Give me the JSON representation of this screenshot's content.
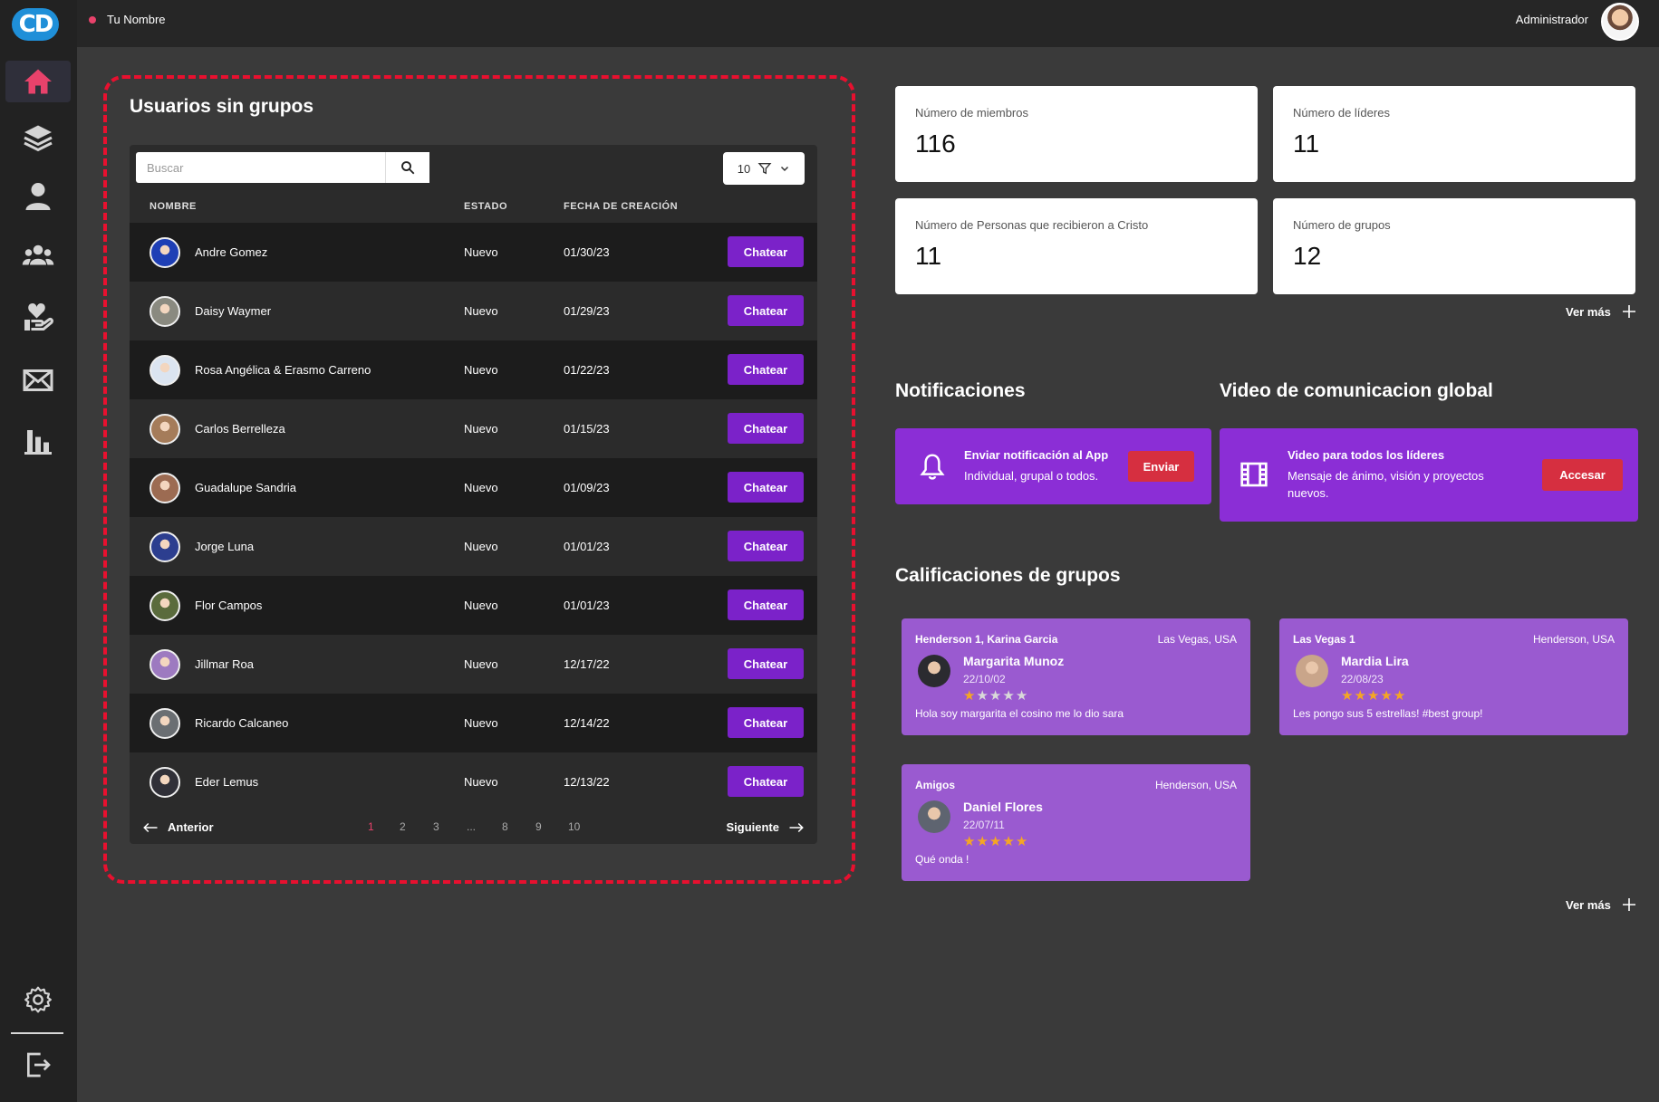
{
  "topbar": {
    "username": "Tu Nombre",
    "admin_label": "Administrador"
  },
  "sidebar": {
    "logo_text": "CD",
    "items": [
      {
        "icon": "home-icon",
        "active": true
      },
      {
        "icon": "layers-icon"
      },
      {
        "icon": "user-icon"
      },
      {
        "icon": "group-icon"
      },
      {
        "icon": "heart-hand-icon"
      },
      {
        "icon": "mail-icon"
      },
      {
        "icon": "bar-chart-icon"
      }
    ],
    "bottom_items": [
      {
        "icon": "gear-icon"
      },
      {
        "icon": "logout-icon"
      }
    ]
  },
  "users_panel": {
    "title": "Usuarios sin grupos",
    "search_placeholder": "Buscar",
    "page_size": "10",
    "headers": {
      "name": "NOMBRE",
      "state": "ESTADO",
      "date": "FECHA DE CREACIÓN"
    },
    "chat_label": "Chatear",
    "rows": [
      {
        "name": "Andre Gomez",
        "state": "Nuevo",
        "date": "01/30/23",
        "avatar_color": "#1e3fb5"
      },
      {
        "name": "Daisy Waymer",
        "state": "Nuevo",
        "date": "01/29/23",
        "avatar_color": "#8a8a80"
      },
      {
        "name": "Rosa Angélica & Erasmo Carreno",
        "state": "Nuevo",
        "date": "01/22/23",
        "avatar_color": "#dbe4f0"
      },
      {
        "name": "Carlos Berrelleza",
        "state": "Nuevo",
        "date": "01/15/23",
        "avatar_color": "#a57c5a"
      },
      {
        "name": "Guadalupe Sandria",
        "state": "Nuevo",
        "date": "01/09/23",
        "avatar_color": "#9c6b52"
      },
      {
        "name": "Jorge Luna",
        "state": "Nuevo",
        "date": "01/01/23",
        "avatar_color": "#2c3e8f"
      },
      {
        "name": "Flor Campos",
        "state": "Nuevo",
        "date": "01/01/23",
        "avatar_color": "#5a6b3c"
      },
      {
        "name": "Jillmar Roa",
        "state": "Nuevo",
        "date": "12/17/22",
        "avatar_color": "#9d7ac0"
      },
      {
        "name": "Ricardo Calcaneo",
        "state": "Nuevo",
        "date": "12/14/22",
        "avatar_color": "#6a6e72"
      },
      {
        "name": "Eder Lemus",
        "state": "Nuevo",
        "date": "12/13/22",
        "avatar_color": "#303038"
      }
    ],
    "pager": {
      "prev_label": "Anterior",
      "next_label": "Siguiente",
      "pages": [
        "1",
        "2",
        "3",
        "...",
        "8",
        "9",
        "10"
      ],
      "current": "1"
    }
  },
  "stats": [
    {
      "label": "Número de miembros",
      "value": "116"
    },
    {
      "label": "Número de líderes",
      "value": "11"
    },
    {
      "label": "Número de Personas que recibieron a Cristo",
      "value": "11"
    },
    {
      "label": "Número de grupos",
      "value": "12"
    }
  ],
  "stats_more": "Ver más",
  "notifications": {
    "title": "Notificaciones",
    "card_title": "Enviar notificación al App",
    "card_sub": "Individual, grupal o todos.",
    "button": "Enviar"
  },
  "video": {
    "title": "Video de comunicacion global",
    "card_title": "Video para todos los líderes",
    "card_sub": "Mensaje de ánimo, visión y proyectos nuevos.",
    "button": "Accesar"
  },
  "ratings": {
    "title": "Calificaciones de grupos",
    "more": "Ver más",
    "items": [
      {
        "group": "Henderson 1, Karina Garcia",
        "location": "Las Vegas, USA",
        "name": "Margarita Munoz",
        "date": "22/10/02",
        "stars": 1,
        "comment": "Hola soy margarita el cosino me lo dio sara",
        "avatar_color": "#2b2b30"
      },
      {
        "group": "Las Vegas 1",
        "location": "Henderson, USA",
        "name": "Mardia Lira",
        "date": "22/08/23",
        "stars": 5,
        "comment": "Les pongo sus 5 estrellas! #best group!",
        "avatar_color": "#c9a58a"
      },
      {
        "group": "Amigos",
        "location": "Henderson, USA",
        "name": "Daniel Flores",
        "date": "22/07/11",
        "stars": 5,
        "comment": "Qué onda !",
        "avatar_color": "#5e6470"
      }
    ]
  },
  "colors": {
    "accent_purple": "#7b22c9",
    "card_purple": "#8b2ed6",
    "rating_purple": "#9a5ad0",
    "alert_red": "#d62f40",
    "highlight_red": "#e8102f",
    "star_gold": "#f5a623",
    "star_empty": "#d9d9d9"
  }
}
